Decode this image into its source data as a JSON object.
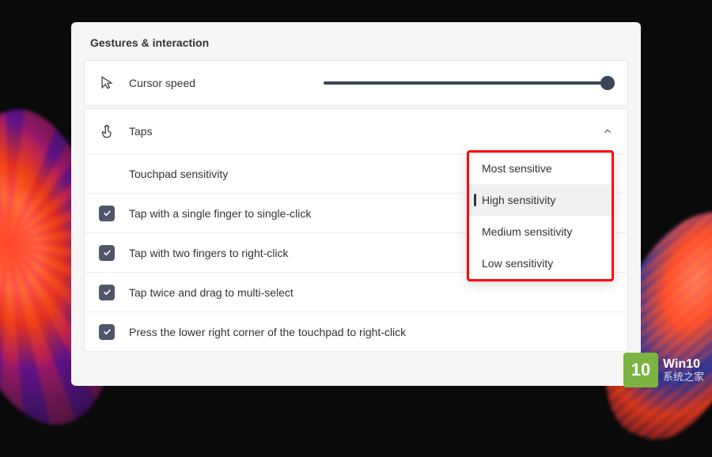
{
  "section_title": "Gestures & interaction",
  "cursor_speed": {
    "label": "Cursor speed",
    "value": 100
  },
  "taps": {
    "label": "Taps",
    "expanded": true,
    "sensitivity": {
      "label": "Touchpad sensitivity",
      "selected": "High sensitivity",
      "options": [
        "Most sensitive",
        "High sensitivity",
        "Medium sensitivity",
        "Low sensitivity"
      ]
    },
    "checks": [
      {
        "label": "Tap with a single finger to single-click",
        "checked": true
      },
      {
        "label": "Tap with two fingers to right-click",
        "checked": true
      },
      {
        "label": "Tap twice and drag to multi-select",
        "checked": true
      },
      {
        "label": "Press the lower right corner of the touchpad to right-click",
        "checked": true
      }
    ]
  },
  "watermark": {
    "badge": "10",
    "line1": "Win10",
    "line2": "系统之家"
  }
}
